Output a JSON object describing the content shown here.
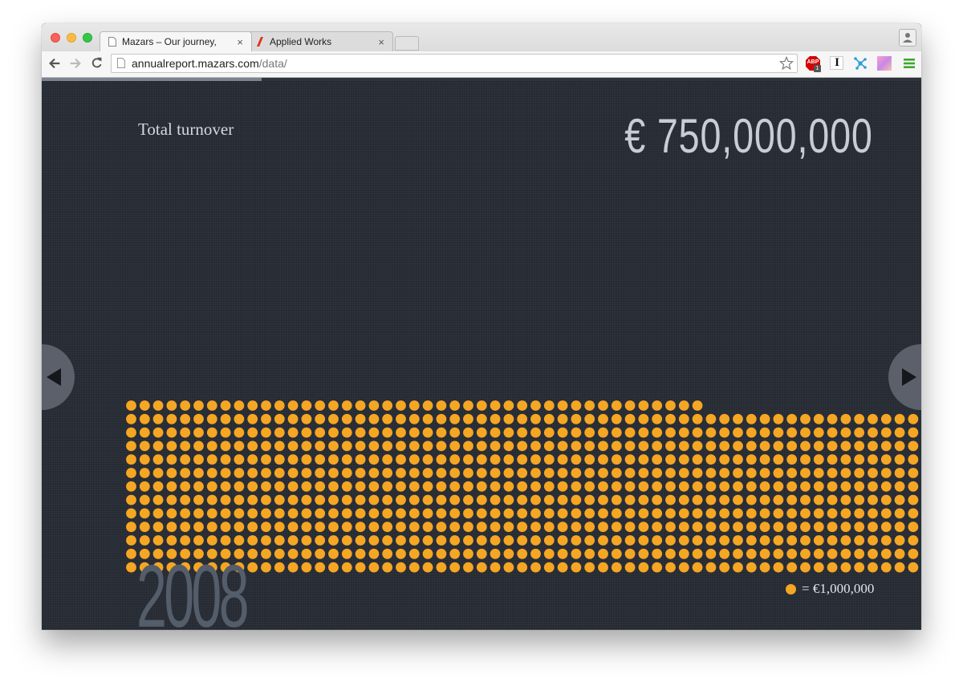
{
  "browser": {
    "tabs": [
      {
        "title": "Mazars – Our journey, told",
        "active": true
      },
      {
        "title": "Applied Works",
        "active": false
      }
    ],
    "close_glyph": "×",
    "url_host": "annualreport.mazars.com",
    "url_path": "/data/",
    "extensions": [
      "adblock-plus-icon",
      "instapaper-icon",
      "molecule-icon",
      "color-picker-icon",
      "menu-icon"
    ],
    "adblock_label": "ABP",
    "adblock_count": "1",
    "instapaper_label": "I"
  },
  "page": {
    "progress_fraction": 0.25,
    "metric_label": "Total turnover",
    "metric_value": "€ 750,000,000",
    "year": "2008",
    "legend_text": "= €1,000,000",
    "colors": {
      "background": "#262a33",
      "dot": "#f5a623",
      "year": "#545d6a",
      "arrow_bg": "#5b606a"
    },
    "dot_grid": {
      "rows": 13,
      "columns": 59,
      "first_row_count": 43,
      "total": 750
    }
  }
}
